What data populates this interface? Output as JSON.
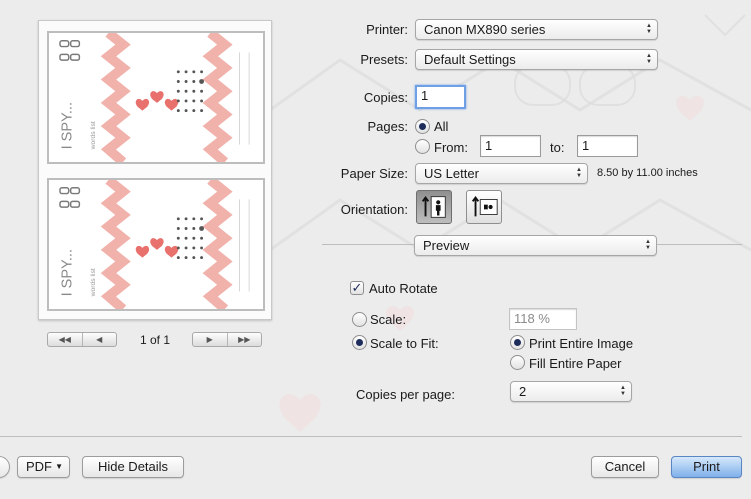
{
  "preview": {
    "page_indicator": "1 of 1",
    "card_title": "I SPY...",
    "card_subtitle": "words list"
  },
  "printer": {
    "label": "Printer:",
    "value": "Canon MX890 series"
  },
  "presets": {
    "label": "Presets:",
    "value": "Default Settings"
  },
  "copies": {
    "label": "Copies:",
    "value": "1"
  },
  "pages": {
    "label": "Pages:",
    "all_label": "All",
    "from_label": "From:",
    "from_value": "1",
    "to_label": "to:",
    "to_value": "1",
    "selected": "All"
  },
  "paper_size": {
    "label": "Paper Size:",
    "value": "US Letter",
    "dimensions": "8.50 by 11.00 inches"
  },
  "orientation": {
    "label": "Orientation:",
    "selected": "portrait"
  },
  "section_popup": {
    "value": "Preview"
  },
  "auto_rotate": {
    "label": "Auto Rotate",
    "checked": true
  },
  "scale": {
    "label": "Scale:",
    "value": "118 %"
  },
  "scale_to_fit": {
    "label": "Scale to Fit:",
    "print_entire_image": "Print Entire Image",
    "fill_entire_paper": "Fill Entire Paper",
    "selected": "Print Entire Image"
  },
  "copies_per_page": {
    "label": "Copies per page:",
    "value": "2"
  },
  "footer": {
    "pdf_label": "PDF",
    "hide_details_label": "Hide Details",
    "cancel_label": "Cancel",
    "print_label": "Print"
  },
  "colors": {
    "accent_pink": "#e8716e",
    "default_button": "#7fb0ea",
    "selection": "#1d2c5a"
  }
}
